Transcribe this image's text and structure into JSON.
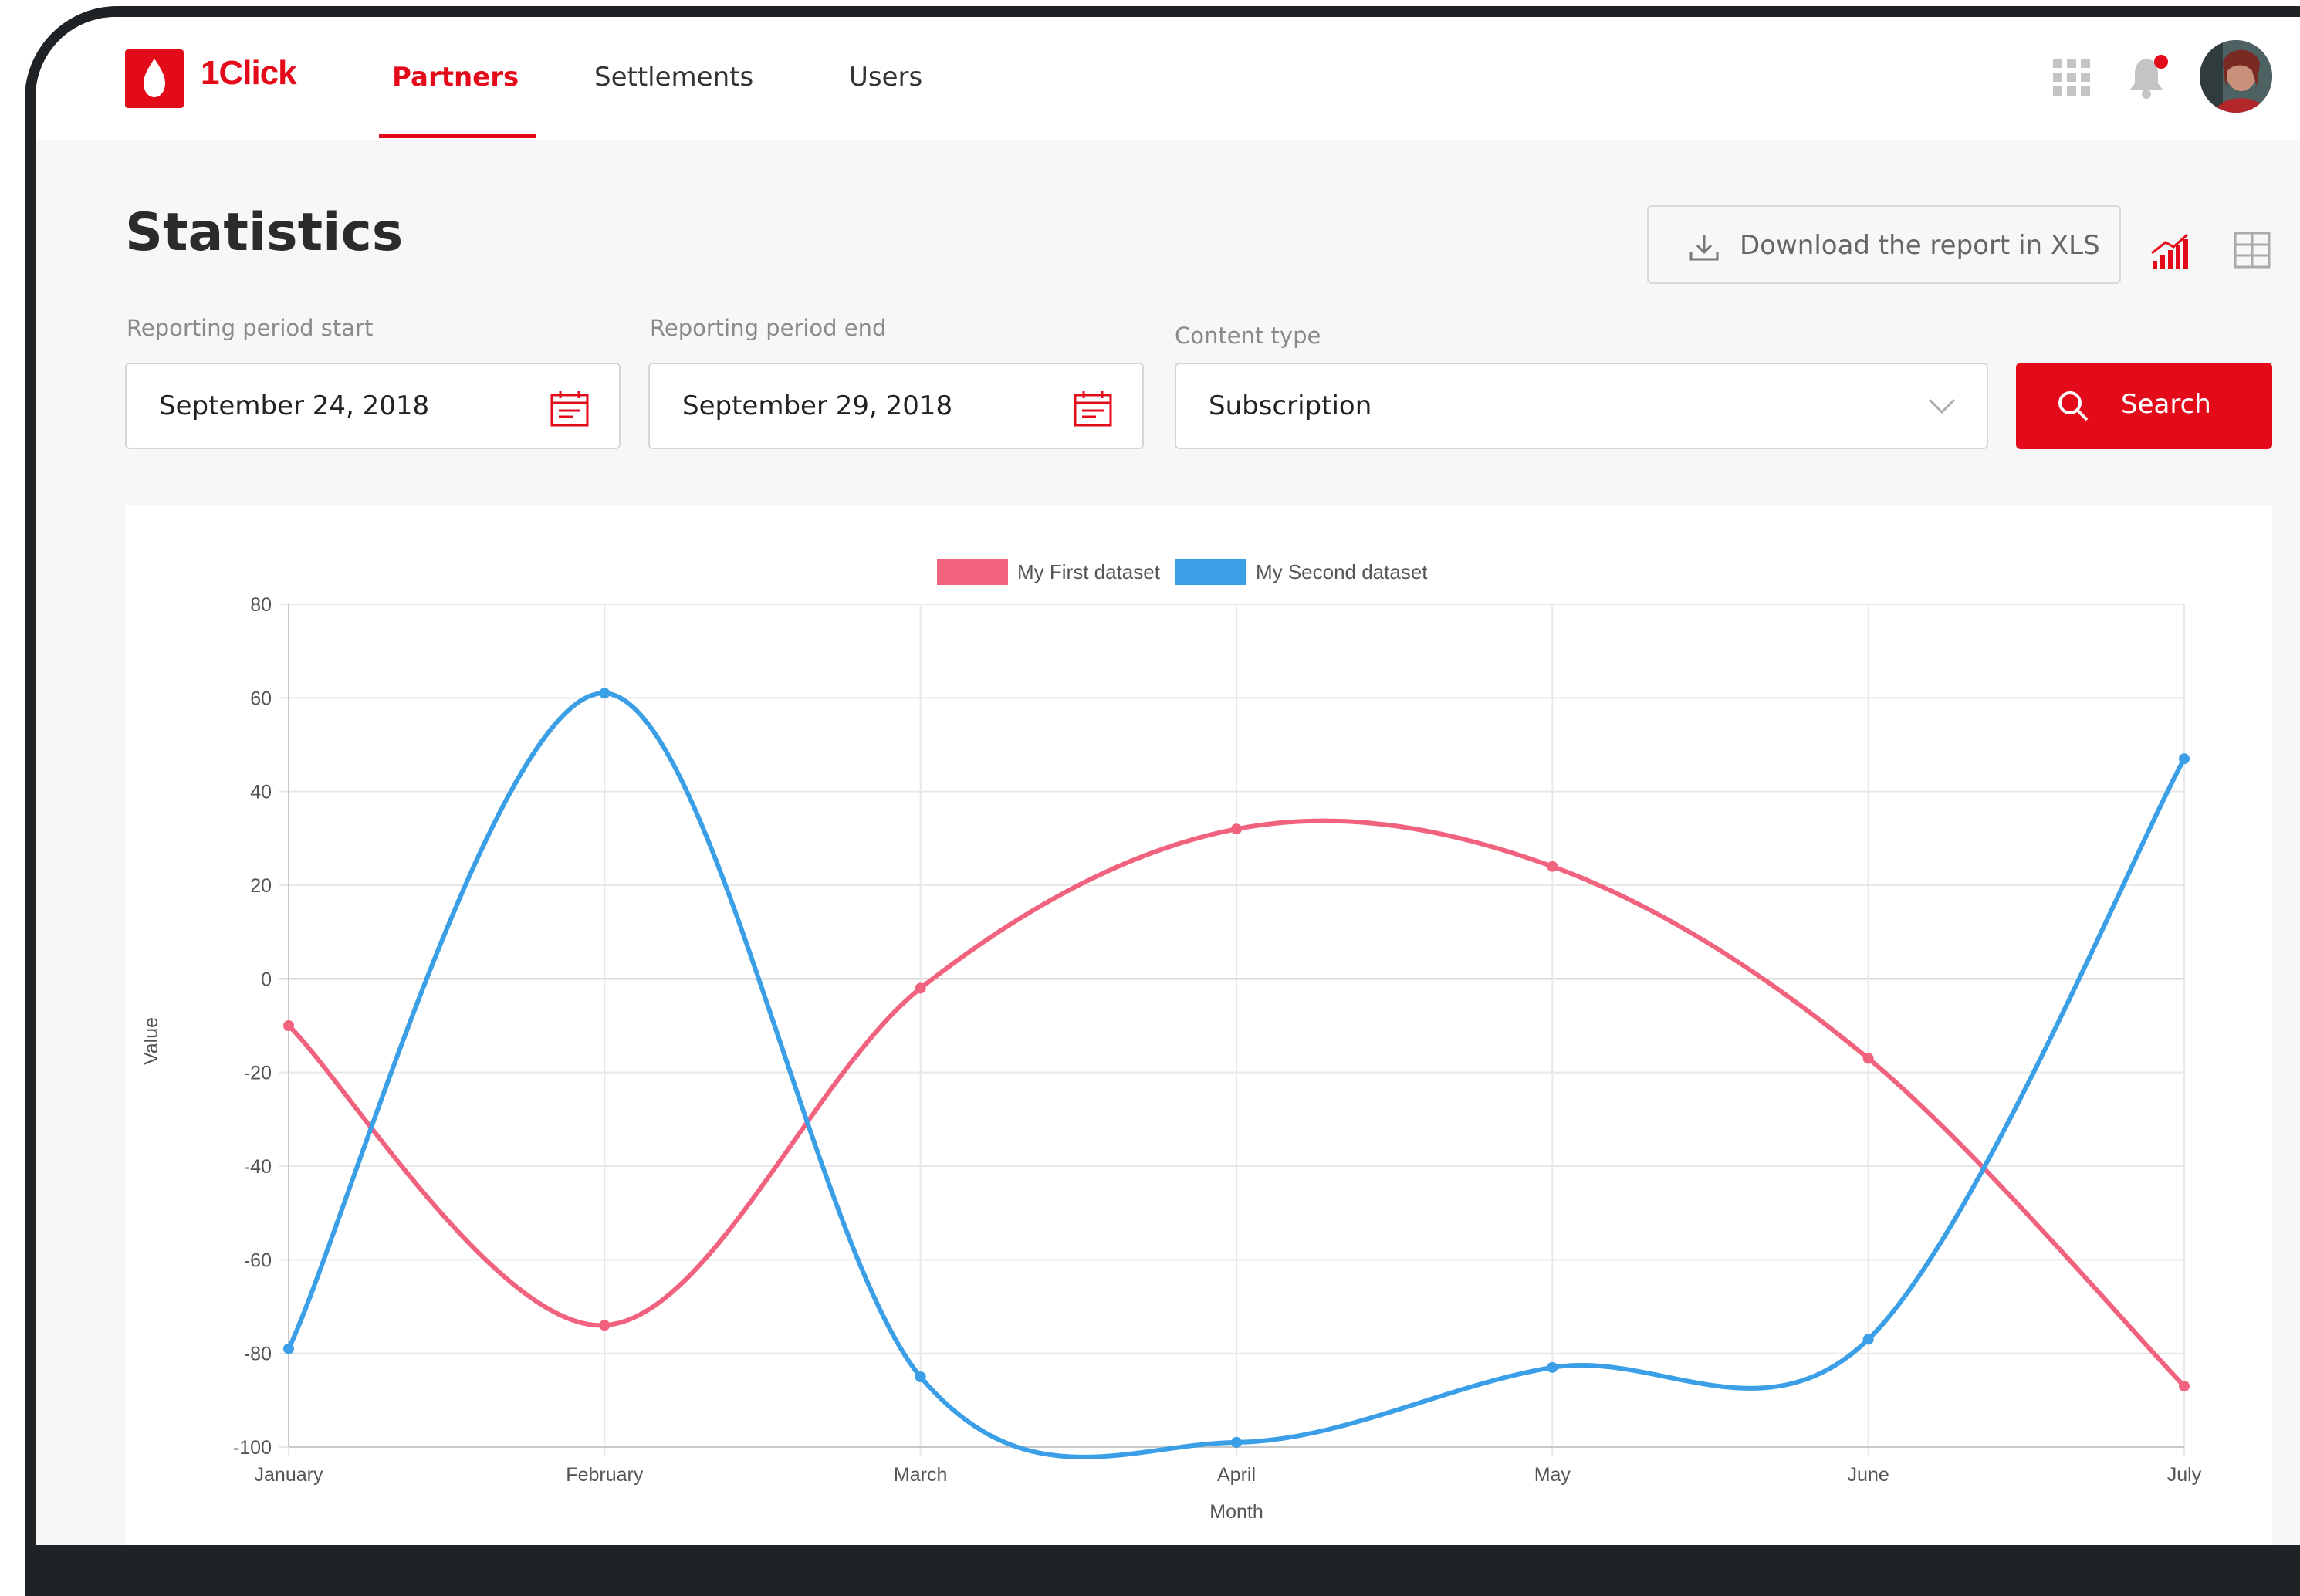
{
  "app": {
    "brand": "1Click",
    "nav_tabs": [
      {
        "label": "Partners",
        "active": true
      },
      {
        "label": "Settlements",
        "active": false
      },
      {
        "label": "Users",
        "active": false
      }
    ],
    "icons": [
      "apps-grid-icon",
      "bell-icon",
      "avatar"
    ],
    "accent_color": "#e30a1a"
  },
  "page": {
    "title": "Statistics",
    "download_label": "Download the report in XLS",
    "view_icons": [
      "chart-view-icon",
      "table-view-icon"
    ]
  },
  "filters": {
    "start_label": "Reporting period start",
    "start_value": "September 24, 2018",
    "end_label": "Reporting period end",
    "end_value": "September 29, 2018",
    "content_label": "Content type",
    "content_value": "Subscription",
    "search_label": "Search"
  },
  "chart_data": {
    "type": "line",
    "categories": [
      "January",
      "February",
      "March",
      "April",
      "May",
      "June",
      "July"
    ],
    "series": [
      {
        "name": "My First dataset",
        "color": "#f0627e",
        "values": [
          -10,
          -74,
          -2,
          32,
          24,
          -17,
          -87
        ]
      },
      {
        "name": "My Second dataset",
        "color": "#3a9fe6",
        "values": [
          -79,
          61,
          -85,
          -99,
          -83,
          -77,
          47
        ]
      }
    ],
    "xlabel": "Month",
    "ylabel": "Value",
    "ylim": [
      -100,
      80
    ],
    "yticks": [
      "80",
      "60",
      "40",
      "20",
      "0",
      "-20",
      "-40",
      "-60",
      "-80",
      "-100"
    ],
    "grid": true,
    "legend": "top-center"
  }
}
